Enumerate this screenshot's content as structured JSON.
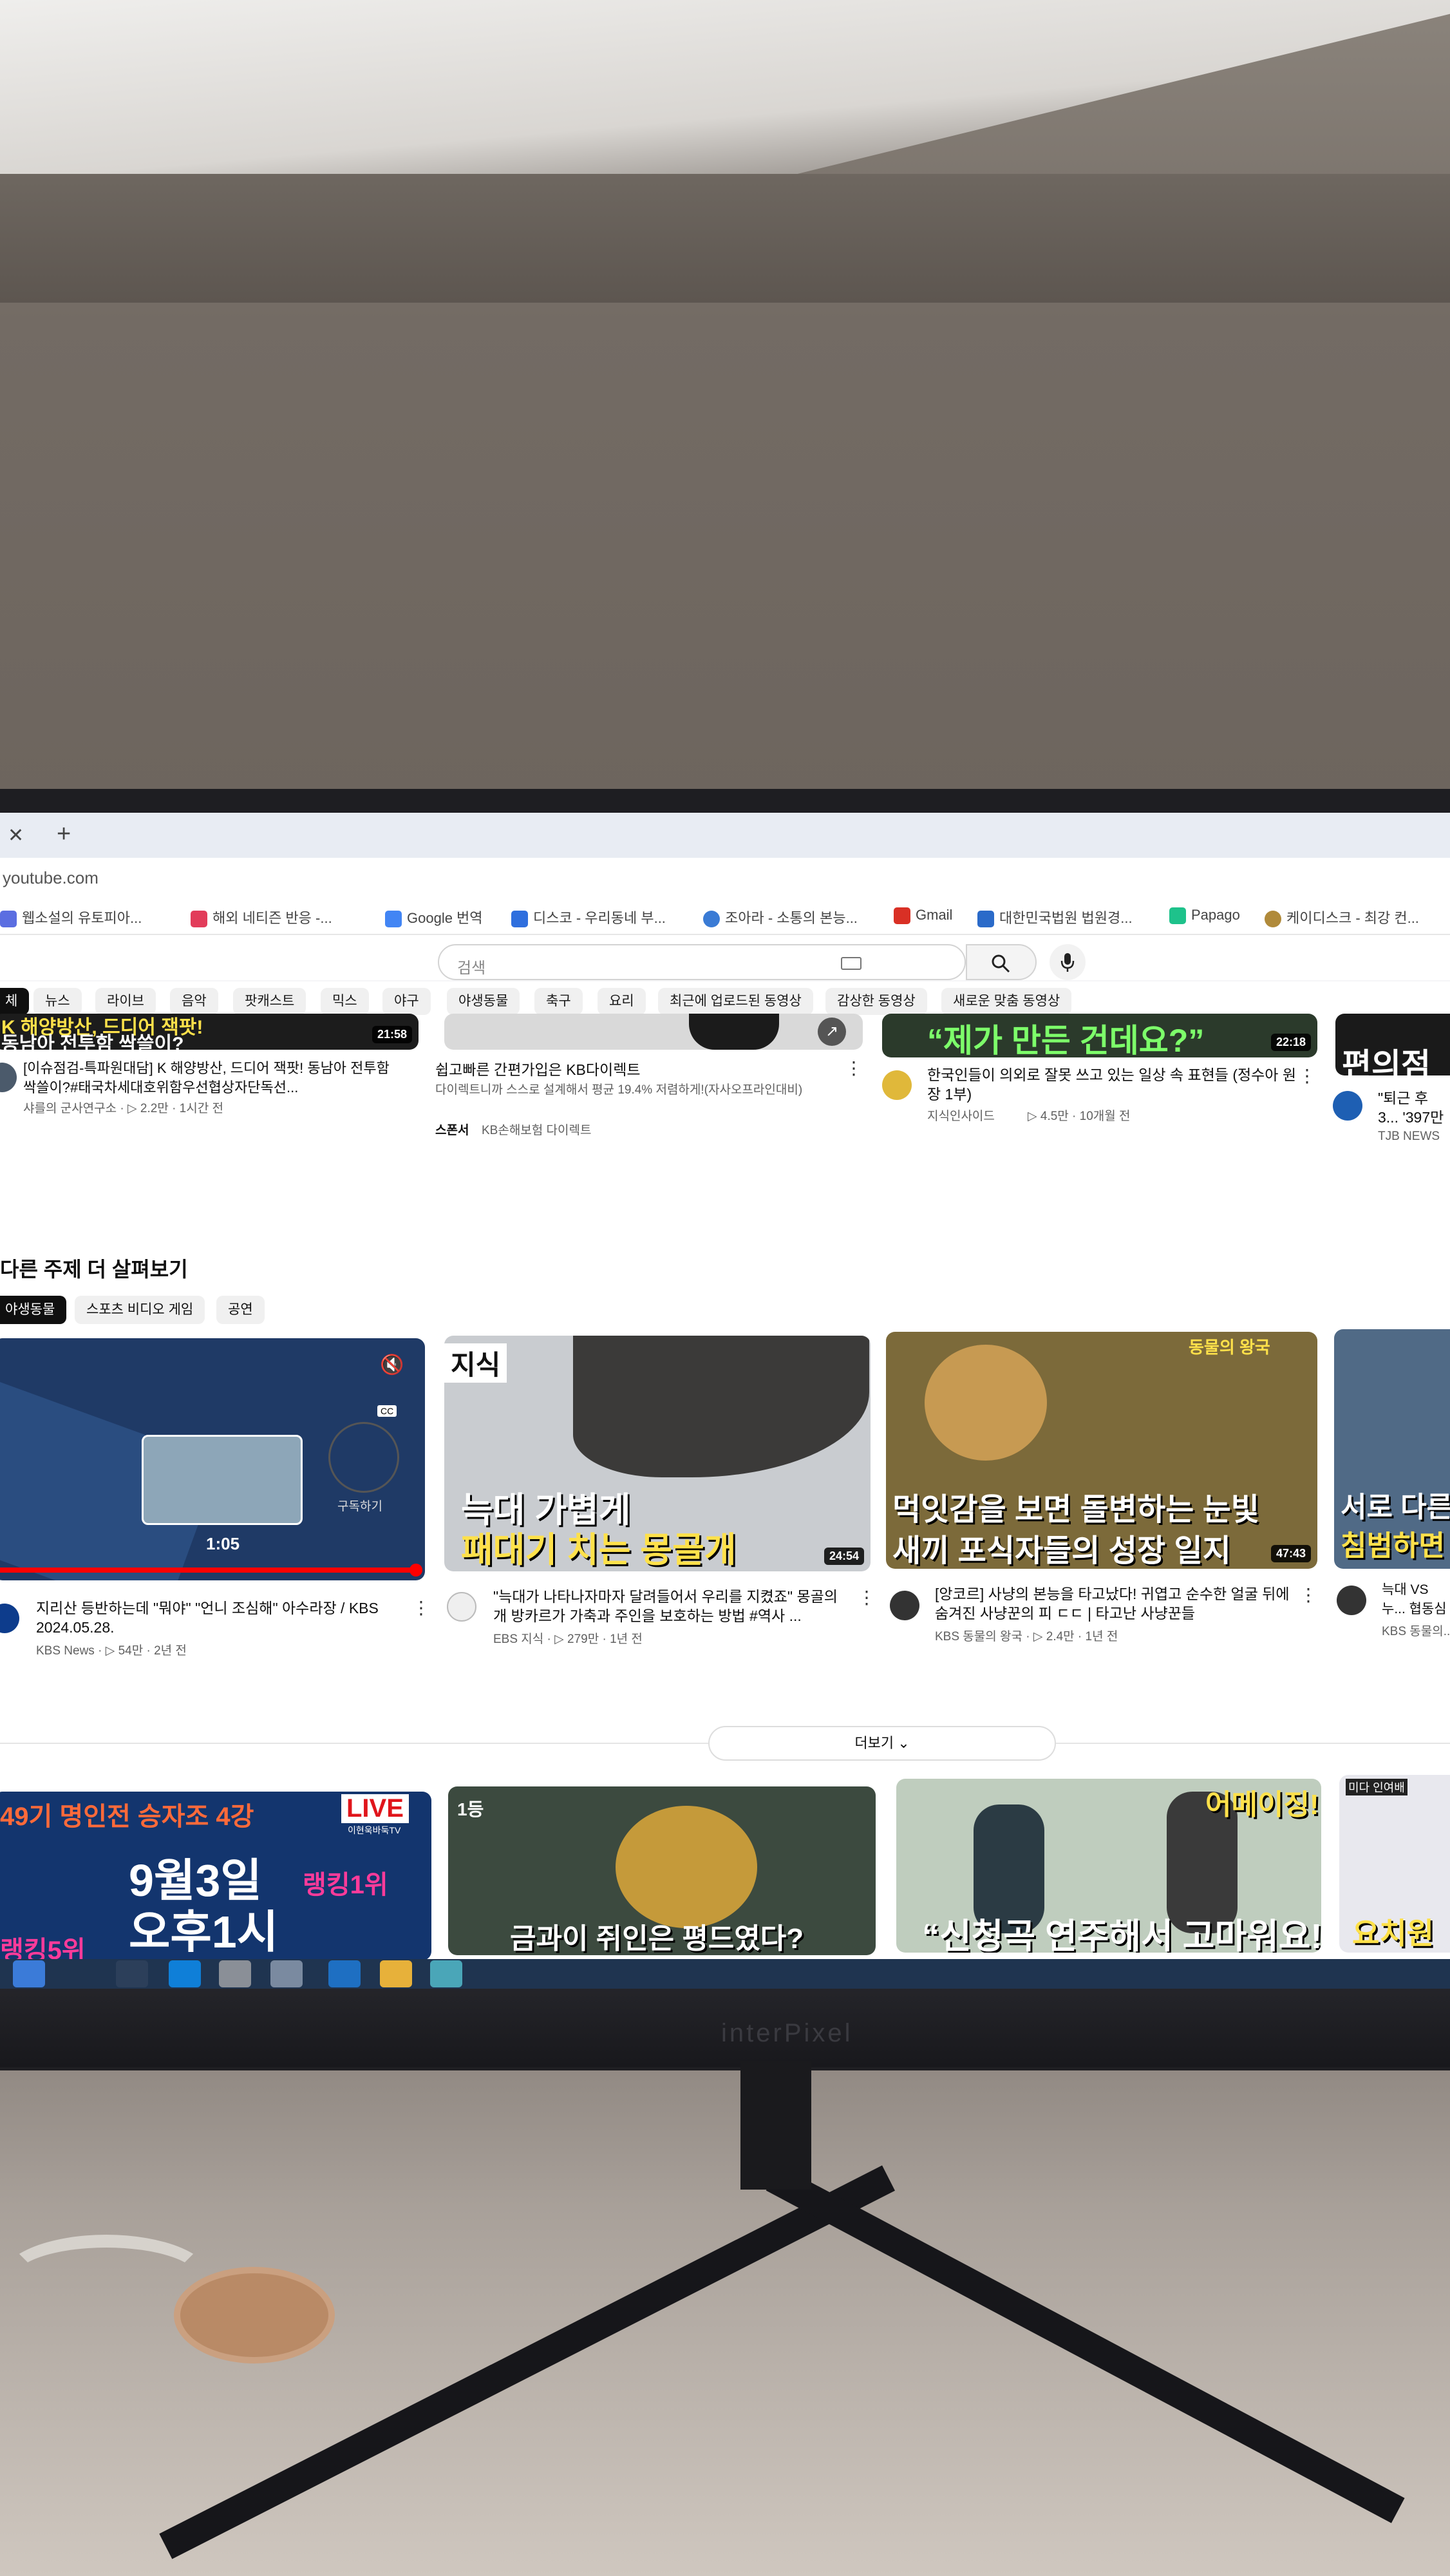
{
  "browser": {
    "tab_close": "✕",
    "tab_new": "+",
    "url": "youtube.com",
    "bookmarks": [
      {
        "label": "웹소설의 유토피아...",
        "color": "#5b6ee1"
      },
      {
        "label": "해외 네티즌 반응 -...",
        "color": "#e23c5a"
      },
      {
        "label": "Google 번역",
        "color": "#4285f4"
      },
      {
        "label": "디스코 - 우리동네 부...",
        "color": "#2f6fde"
      },
      {
        "label": "조아라 - 소통의 본능...",
        "color": "#3a7bd5"
      },
      {
        "label": "Gmail",
        "color": "#d93025"
      },
      {
        "label": "대한민국법원 법원경...",
        "color": "#2a6ac9"
      },
      {
        "label": "Papago",
        "color": "#1ec28b"
      },
      {
        "label": "케이디스크 - 최강 컨...",
        "color": "#b08a3a"
      }
    ]
  },
  "search": {
    "placeholder": "검색"
  },
  "chips": [
    "체",
    "뉴스",
    "라이브",
    "음악",
    "팟캐스트",
    "믹스",
    "야구",
    "야생동물",
    "축구",
    "요리",
    "최근에 업로드된 동영상",
    "감상한 동영상",
    "새로운 맞춤 동영상"
  ],
  "row1": [
    {
      "thumb_line1": "K 해양방산, 드디어 잭팟!",
      "thumb_line2": "동남아 전투함 싹쓸이?",
      "duration": "21:58",
      "title": "[이슈점검-특파원대담] K 해양방산, 드디어 잭팟! 동남아 전투함 싹쓸이?#태국차세대호위함우선협상자단독선...",
      "meta": "샤를의 군사연구소 · ▷ 2.2만 · 1시간 전"
    },
    {
      "title": "쉽고빠른 간편가입은 KB다이렉트",
      "desc": "다이렉트니까 스스로 설계해서 평균 19.4% 저렴하게!(자사오프라인대비)",
      "sponsor_label": "스폰서",
      "sponsor": "KB손해보험 다이렉트"
    },
    {
      "thumb_text": "“제가 만든 건데요?”",
      "duration": "22:18",
      "title": "한국인들이 의외로 잘못 쓰고 있는 일상 속 표현들 (정수아 원장 1부)",
      "channel": "지식인사이드",
      "meta": "▷ 4.5만 · 10개월 전"
    },
    {
      "thumb_text": "편의점",
      "title": "\"퇴근 후 3... '397만 뷰'...",
      "channel": "TJB NEWS"
    }
  ],
  "section": {
    "title": "다른 주제 더 살펴보기",
    "chips": [
      "야생동물",
      "스포츠 비디오 게임",
      "공연"
    ]
  },
  "row2": [
    {
      "player_time": "1:05",
      "subscribe": "구독하기",
      "cc": "CC",
      "title": "지리산 등반하는데 \"뭐야\" \"언니 조심해\" 아수라장 / KBS 2024.05.28.",
      "meta": "KBS News · ▷ 54만 · 2년 전"
    },
    {
      "tag": "지식",
      "thumb_line1": "늑대 가볍게",
      "thumb_line2": "패대기 치는 몽골개",
      "duration": "24:54",
      "title": "\"늑대가 나타나자마자 달려들어서 우리를 지켰죠\" 몽골의 개 방카르가 가축과 주인을 보호하는 방법 #역사 ...",
      "meta": "EBS 지식 · ▷ 279만 · 1년 전"
    },
    {
      "tag": "동물의 왕국",
      "thumb_line1": "먹잇감을 보면 돌변하는 눈빛",
      "thumb_line2": "새끼 포식자들의 성장 일지",
      "duration": "47:43",
      "title": "[앙코르] 사냥의 본능을 타고났다! 귀엽고 순수한 얼굴 뒤에 숨겨진 사냥꾼의 피 ㄷㄷ | 타고난 사냥꾼들",
      "meta": "KBS 동물의 왕국 · ▷ 2.4만 · 1년 전"
    },
    {
      "thumb_line1": "서로 다른",
      "thumb_line2": "침범하면",
      "title": "늑대 VS 누... 협동심과 ...",
      "meta": "KBS 동물의..."
    }
  ],
  "more_label": "더보기",
  "row3": [
    {
      "line1": "49기 명인전 승자조 4강",
      "live": "LIVE",
      "live_sub": "이현욱바둑TV",
      "line2": "9월3일",
      "line3": "오후1시",
      "left_tag": "랭킹5위",
      "right_tag": "랭킹1위"
    },
    {
      "badge": "1등",
      "line1": "금과이 쥐인은 평드였다?"
    },
    {
      "tag": "어메이징!",
      "line1": "“신청곡 연주해서 고마워요!”"
    },
    {
      "tag": "미다 인여배",
      "line1": "요치원"
    }
  ],
  "colors": {
    "brand_red": "#ff0000",
    "thumb_yellow": "#ffe14a",
    "thumb_green": "#7dff6a"
  }
}
